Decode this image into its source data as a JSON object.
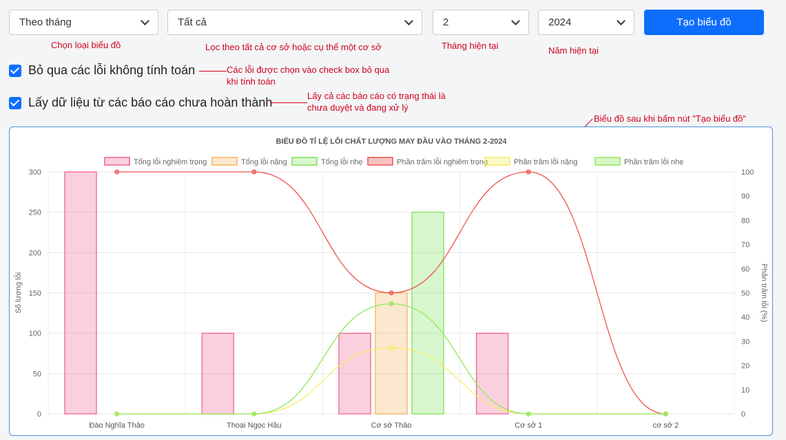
{
  "controls": {
    "chart_type_select": "Theo tháng",
    "filter_select": "Tất cả",
    "month_select": "2",
    "year_select": "2024",
    "create_button": "Tạo biểu đồ"
  },
  "annotations": {
    "chart_type": "Chọn loại biểu đồ",
    "filter": "Lọc  theo tất cả cơ sở hoặc cụ thể một cơ sở",
    "month": "Tháng hiện tại",
    "year": "Năm hiện tại",
    "skip_errors_line1": "Các lỗi được chọn vào check box bỏ qua",
    "skip_errors_line2": "khi tính toán",
    "incomplete_line1": "Lấy cả các báo cáo có trạng thái là",
    "incomplete_line2": "chưa duyệt và đang xử lý",
    "chart_note": "Biểu đồ sau khi bấm nút \"Tạo biểu đồ\""
  },
  "checkboxes": {
    "skip_errors": "Bỏ qua các lỗi không tính toán",
    "include_incomplete": "Lấy dữ liệu từ các báo cáo chưa hoàn thành"
  },
  "chart_data": {
    "type": "bar",
    "title": "BIỂU ĐỒ TỈ LỆ LỖI CHẤT LƯỢNG MAY ĐẦU VÀO THÁNG 2-2024",
    "categories": [
      "Đào Nghĩa Thảo",
      "Thoại Ngọc Hầu",
      "Cơ sở Thảo",
      "Cơ sở 1",
      "cơ sở 2"
    ],
    "ylabel": "Số lượng lỗi",
    "y2label": "Phần trăm lỗi (%)",
    "ylim": [
      0,
      300
    ],
    "y2lim": [
      0,
      100
    ],
    "yticks": [
      "0",
      "50",
      "100",
      "150",
      "200",
      "250",
      "300"
    ],
    "y2ticks": [
      "0",
      "10",
      "20",
      "30",
      "40",
      "50",
      "60",
      "70",
      "80",
      "90",
      "100"
    ],
    "legend_position": "top",
    "grid": true,
    "bar_series": [
      {
        "name": "Tổng lỗi nghiêm trọng",
        "values": [
          300,
          100,
          100,
          100,
          0
        ],
        "color": "#f06292"
      },
      {
        "name": "Tổng lỗi nặng",
        "values": [
          0,
          0,
          150,
          0,
          0
        ],
        "color": "#f5b25c"
      },
      {
        "name": "Tổng lỗi nhẹ",
        "values": [
          0,
          0,
          250,
          0,
          0
        ],
        "color": "#7ee05a"
      }
    ],
    "line_series": [
      {
        "name": "Phần trăm lỗi nghiêm trọng",
        "values": [
          100,
          100,
          50,
          100,
          0
        ],
        "color": "#ef5350"
      },
      {
        "name": "Phần trăm lỗi nặng",
        "values": [
          0,
          0,
          27.3,
          0,
          0
        ],
        "color": "#f5ee62"
      },
      {
        "name": "Phần trăm lỗi nhẹ",
        "values": [
          0,
          0,
          45.5,
          0,
          0
        ],
        "color": "#8fe85a"
      }
    ]
  }
}
